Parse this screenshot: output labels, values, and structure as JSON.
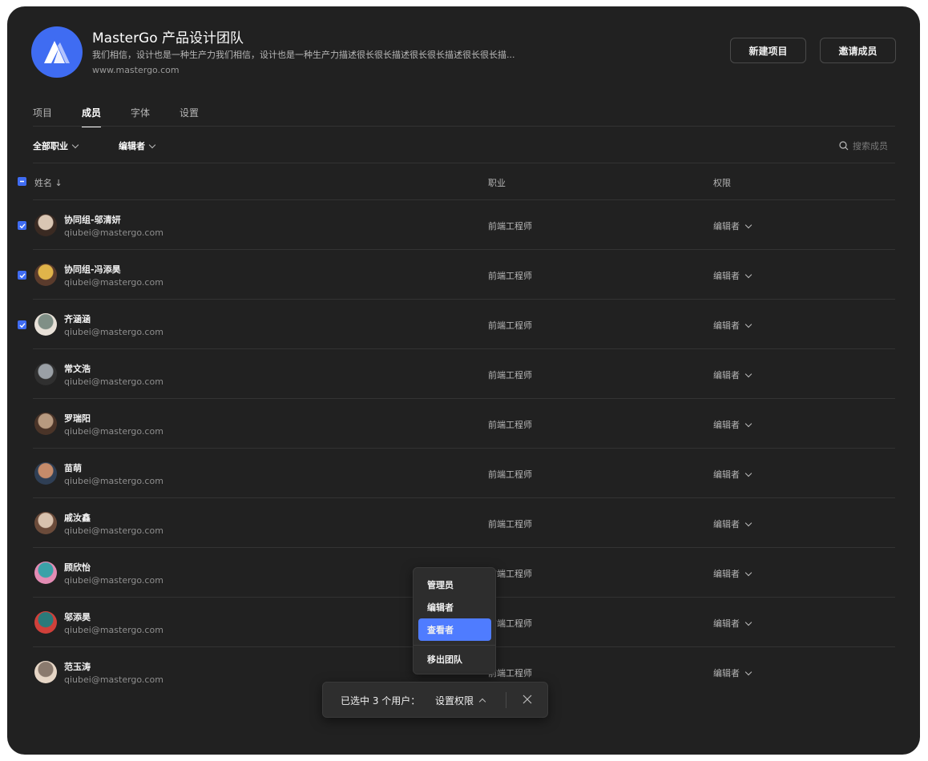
{
  "team": {
    "name": "MasterGo 产品设计团队",
    "description": "我们相信，设计也是一种生产力我们相信，设计也是一种生产力描述很长很长描述很长很长描述很长很长描...",
    "url": "www.mastergo.com"
  },
  "header_buttons": {
    "new_project": "新建项目",
    "invite": "邀请成员"
  },
  "tabs": [
    {
      "label": "项目",
      "active": false
    },
    {
      "label": "成员",
      "active": true
    },
    {
      "label": "字体",
      "active": false
    },
    {
      "label": "设置",
      "active": false
    }
  ],
  "filters": {
    "job": "全部职业",
    "role": "编辑者",
    "search_placeholder": "搜索成员"
  },
  "table": {
    "headers": {
      "name": "姓名 ↓",
      "job": "职业",
      "role": "权限"
    },
    "rows": [
      {
        "name": "协同组-邬清妍",
        "email": "qiubei@mastergo.com",
        "job": "前端工程师",
        "role": "编辑者",
        "checked": true
      },
      {
        "name": "协同组-冯添昊",
        "email": "qiubei@mastergo.com",
        "job": "前端工程师",
        "role": "编辑者",
        "checked": true
      },
      {
        "name": "齐涵涵",
        "email": "qiubei@mastergo.com",
        "job": "前端工程师",
        "role": "编辑者",
        "checked": true
      },
      {
        "name": "常文浩",
        "email": "qiubei@mastergo.com",
        "job": "前端工程师",
        "role": "编辑者",
        "checked": false
      },
      {
        "name": "罗瑞阳",
        "email": "qiubei@mastergo.com",
        "job": "前端工程师",
        "role": "编辑者",
        "checked": false
      },
      {
        "name": "苗萌",
        "email": "qiubei@mastergo.com",
        "job": "前端工程师",
        "role": "编辑者",
        "checked": false
      },
      {
        "name": "戚汝鑫",
        "email": "qiubei@mastergo.com",
        "job": "前端工程师",
        "role": "编辑者",
        "checked": false
      },
      {
        "name": "顾欣怡",
        "email": "qiubei@mastergo.com",
        "job": "前端工程师",
        "role": "编辑者",
        "checked": false
      },
      {
        "name": "邬添昊",
        "email": "qiubei@mastergo.com",
        "job": "前端工程师",
        "role": "编辑者",
        "checked": false
      },
      {
        "name": "范玉涛",
        "email": "qiubei@mastergo.com",
        "job": "前端工程师",
        "role": "编辑者",
        "checked": false
      }
    ]
  },
  "role_menu": {
    "items": [
      "管理员",
      "编辑者",
      "查看者"
    ],
    "selected": "查看者",
    "remove": "移出团队"
  },
  "selection_bar": {
    "selected_text": "已选中 3 个用户：",
    "set_permission": "设置权限"
  },
  "colors": {
    "accent": "#3f6cf2",
    "menu_selected": "#4f7cff",
    "window_bg": "#212121"
  },
  "icons": [
    "mastergo-logo-icon",
    "chevron-down-icon",
    "search-icon",
    "sort-down-icon",
    "checkbox-checked-icon",
    "checkbox-indeterminate-icon",
    "chevron-up-icon",
    "close-icon"
  ]
}
